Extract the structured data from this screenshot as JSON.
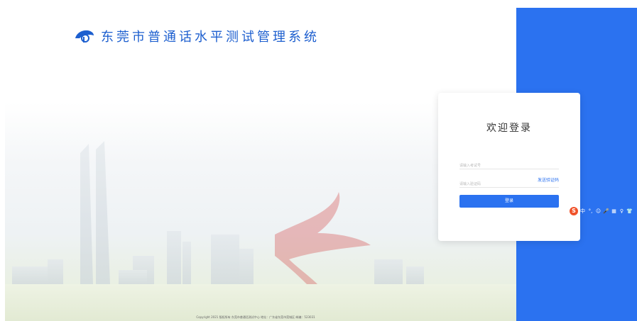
{
  "header": {
    "title": "东莞市普通话水平测试管理系统",
    "logo_icon": "megaphone-logo-icon"
  },
  "login": {
    "title": "欢迎登录",
    "account_placeholder": "请输入考试号",
    "code_placeholder": "请输入验证码",
    "send_code_label": "发送验证码",
    "login_button_label": "登录"
  },
  "footer": {
    "text": "Copyright 2021 版权所有 东莞市普通话测试中心 地址：广东省东莞市莞城区 邮编：523031"
  },
  "ime_toolbar": {
    "logo_letter": "S",
    "items": [
      "中",
      "°,",
      "☺",
      "🎤",
      "▦",
      "♀",
      "👕"
    ]
  },
  "colors": {
    "accent": "#2b72f0",
    "title": "#1d5fcf",
    "ime": "#f0522a"
  }
}
